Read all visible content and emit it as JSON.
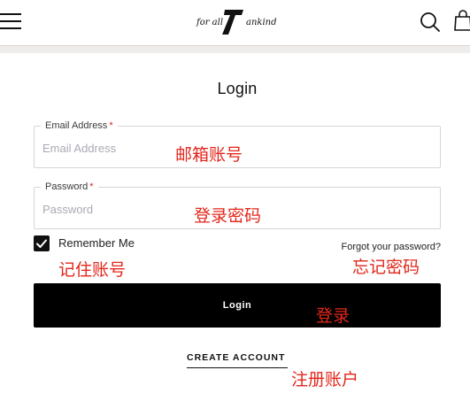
{
  "header": {
    "logo_text": "for all mankind",
    "logo_mark": "7",
    "menu_icon": "hamburger-menu-icon",
    "search_icon": "search-icon",
    "bag_icon": "shopping-bag-icon"
  },
  "page_title": "Login",
  "form": {
    "email": {
      "label": "Email Address",
      "required_mark": "*",
      "placeholder": "Email Address",
      "value": ""
    },
    "password": {
      "label": "Password",
      "required_mark": "*",
      "placeholder": "Password",
      "value": ""
    },
    "remember": {
      "label": "Remember Me",
      "checked": true
    },
    "forgot_link": "Forgot your password?",
    "login_button": "Login",
    "create_account": "CREATE ACCOUNT"
  },
  "annotations": {
    "email": "邮箱账号",
    "password": "登录密码",
    "remember": "记住账号",
    "forgot": "忘记密码",
    "login": "登录",
    "create": "注册账户"
  },
  "colors": {
    "annotation": "#e3271c",
    "required": "#d9262c",
    "button_bg": "#000000",
    "header_band": "#efedeb"
  }
}
